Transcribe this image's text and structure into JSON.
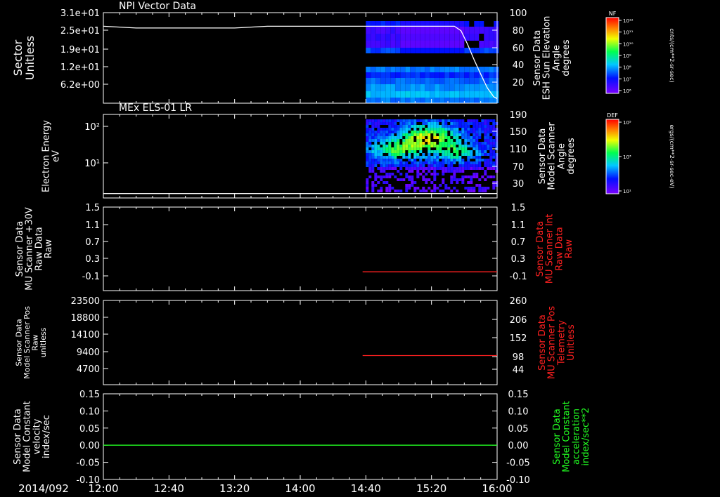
{
  "figure": {
    "date_label": "2014/092",
    "x_ticks": [
      "12:00",
      "12:40",
      "13:20",
      "14:00",
      "14:40",
      "15:20",
      "16:00"
    ]
  },
  "colorbars": [
    {
      "title": "NF",
      "units": "cnts/(cm**2-sr-sec)",
      "labels": [
        "10¹²",
        "10¹¹",
        "10¹⁰",
        "10⁹",
        "10⁸",
        "10⁷",
        "10⁶"
      ]
    },
    {
      "title": "DEF",
      "units": "ergs/(cm**2-sr-sec-eV)",
      "labels": [
        "10⁵",
        "10³",
        "10¹"
      ]
    }
  ],
  "chart_data": [
    {
      "type": "heatmap",
      "title": "NPI Vector Data",
      "ylabel": [
        "Sector",
        "Unitless"
      ],
      "y_ticks": [
        "3.1e+01",
        "2.5e+01",
        "1.9e+01",
        "1.2e+01",
        "6.2e+00"
      ],
      "y2label": [
        "Sensor Data",
        "ESH Sun Elevation",
        "Angle",
        "degrees"
      ],
      "y2_ticks": [
        "100",
        "80",
        "60",
        "40",
        "20"
      ],
      "y2lim": [
        0,
        100
      ],
      "line_color": "#ffffff",
      "line": {
        "x": [
          "12:00",
          "12:20",
          "12:40",
          "13:00",
          "13:20",
          "13:40",
          "14:00",
          "14:40",
          "15:20",
          "15:34",
          "15:38",
          "15:42",
          "15:46",
          "15:50",
          "15:54",
          "15:58",
          "16:00"
        ],
        "y": [
          85,
          83,
          83,
          83,
          83,
          85,
          85,
          85,
          85,
          85,
          80,
          65,
          48,
          32,
          17,
          7,
          5
        ]
      },
      "heatmap_span": [
        "14:40",
        "16:00"
      ]
    },
    {
      "type": "heatmap",
      "title": "MEx ELS-01 LR",
      "ylabel": [
        "Electron Energy",
        "eV"
      ],
      "y_ticks": [
        "10²",
        "10¹"
      ],
      "y2label": [
        "Sensor Data",
        "Model Scanner",
        "Angle",
        "degrees"
      ],
      "y2_ticks": [
        "190",
        "150",
        "110",
        "70",
        "30"
      ],
      "y2lim": [
        0,
        190
      ],
      "line_color": "#ffffff",
      "line": {
        "x": [
          "12:00",
          "16:00"
        ],
        "y": [
          10,
          10
        ]
      },
      "heatmap_span": [
        "14:40",
        "16:00"
      ]
    },
    {
      "type": "line",
      "ylabel": [
        "Sensor Data",
        "MU Scanner +30V",
        "Raw Data",
        "Raw"
      ],
      "y_ticks": [
        "1.5",
        "1.1",
        "0.7",
        "0.3",
        "-0.1"
      ],
      "ylim": [
        -0.5,
        1.5
      ],
      "y2label": [
        "Sensor Data",
        "MU Scanner Int",
        "Raw Data",
        "Raw"
      ],
      "y2_ticks": [
        "1.5",
        "1.1",
        "0.7",
        "0.3",
        "-0.1"
      ],
      "y2lim": [
        -0.5,
        1.5
      ],
      "label2_color": "#ff2020",
      "line_color": "#ff2020",
      "series": [
        {
          "x": [
            "14:38",
            "16:00"
          ],
          "y": [
            -0.05,
            -0.05
          ]
        }
      ]
    },
    {
      "type": "line",
      "ylabel": [
        "Sensor Data",
        "Model Scanner Pos",
        "Raw",
        "unitless"
      ],
      "y_ticks": [
        "23500",
        "18800",
        "14100",
        "9400",
        "4700"
      ],
      "ylim": [
        0,
        23500
      ],
      "y2label": [
        "Sensor Data",
        "MU Scanner Pos",
        "Telemetry",
        "Unitless"
      ],
      "y2_ticks": [
        "260",
        "206",
        "152",
        "98",
        "44"
      ],
      "y2lim": [
        0,
        260
      ],
      "label2_color": "#ff2020",
      "line_color": "#ff2020",
      "series": [
        {
          "x": [
            "14:38",
            "16:00"
          ],
          "y2": [
            90,
            90
          ]
        }
      ]
    },
    {
      "type": "line",
      "ylabel": [
        "Sensor Data",
        "Model Constant",
        "velocity",
        "index/sec"
      ],
      "y_ticks": [
        "0.15",
        "0.10",
        "0.05",
        "0.00",
        "-0.05",
        "-0.10"
      ],
      "ylim": [
        -0.1,
        0.15
      ],
      "y2label": [
        "Sensor Data",
        "Model Constant",
        "acceleration",
        "index/sec**2"
      ],
      "y2_ticks": [
        "0.15",
        "0.10",
        "0.05",
        "0.00",
        "-0.05",
        "-0.10"
      ],
      "y2lim": [
        -0.1,
        0.15
      ],
      "label2_color": "#22ff22",
      "line_color": "#22ff22",
      "series": [
        {
          "x": [
            "12:00",
            "16:00"
          ],
          "y": [
            0.0,
            0.0
          ]
        }
      ]
    }
  ]
}
